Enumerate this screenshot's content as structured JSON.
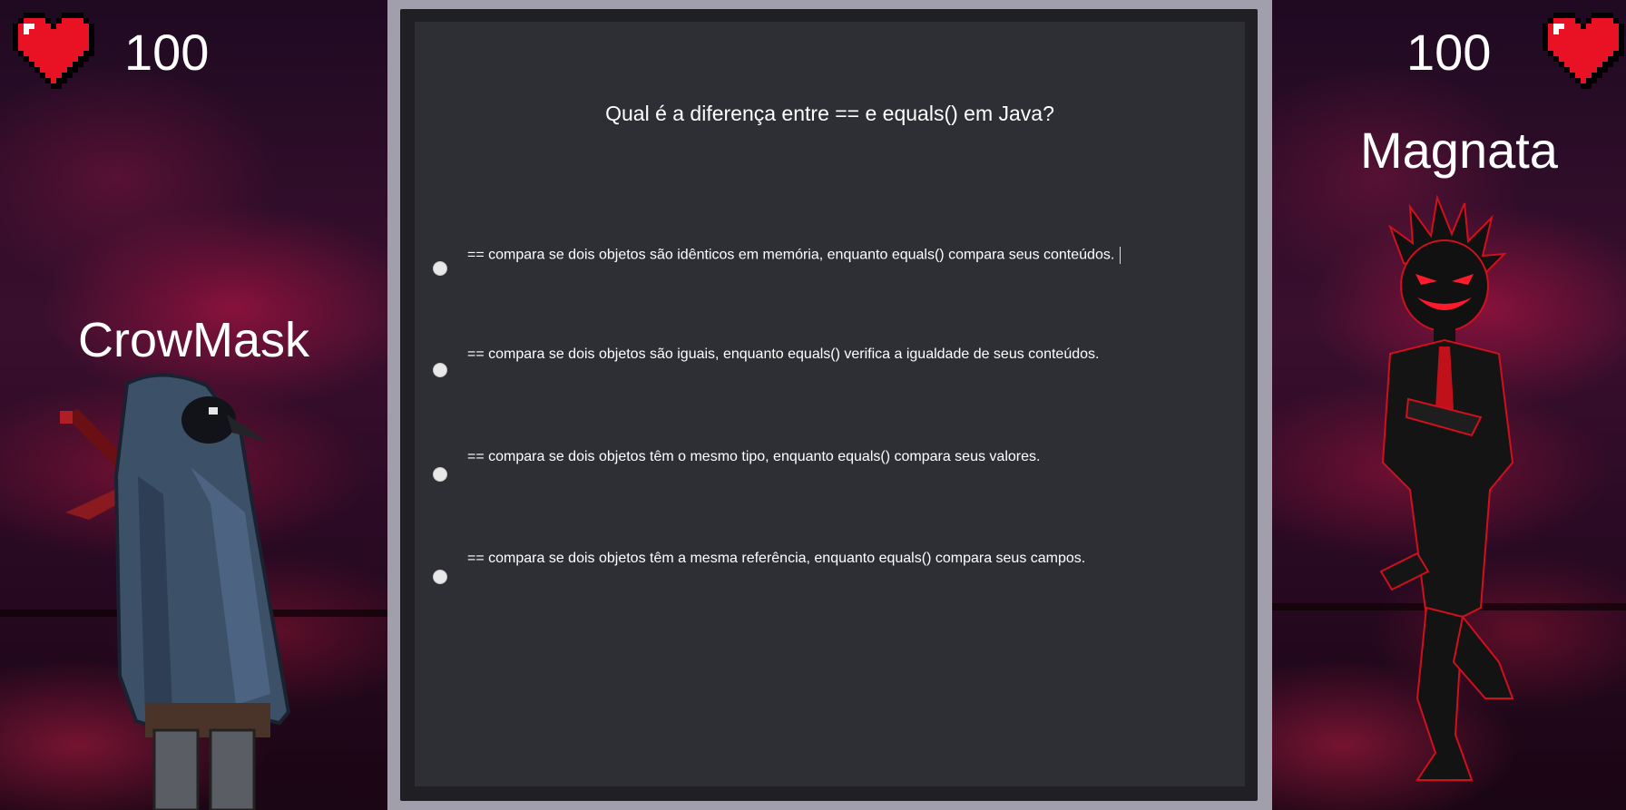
{
  "player": {
    "name": "CrowMask",
    "hp": "100"
  },
  "enemy": {
    "name": "Magnata",
    "hp": "100"
  },
  "quiz": {
    "question": "Qual é a diferença entre == e equals() em Java?",
    "options": [
      "== compara se dois objetos são idênticos em memória, enquanto equals() compara seus conteúdos.",
      "== compara se dois objetos são iguais, enquanto equals() verifica a igualdade de seus conteúdos.",
      "== compara se dois objetos têm o mesmo tipo, enquanto equals() compara seus valores.",
      "== compara se dois objetos têm a mesma referência, enquanto equals() compara seus campos."
    ]
  },
  "icons": {
    "hp": "heart-icon",
    "choice": "radio-button"
  },
  "colors": {
    "panel_frame": "#a19fab",
    "panel_bg": "#2e2e35",
    "heart": "#e81224",
    "scene_accent": "#c8143c"
  }
}
